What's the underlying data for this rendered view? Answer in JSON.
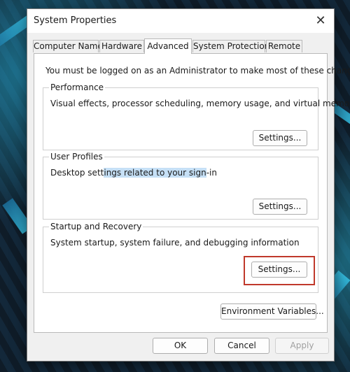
{
  "dialog": {
    "title": "System Properties",
    "close_glyph": "✕"
  },
  "tabs": [
    {
      "label": "Computer Name"
    },
    {
      "label": "Hardware"
    },
    {
      "label": "Advanced"
    },
    {
      "label": "System Protection"
    },
    {
      "label": "Remote"
    }
  ],
  "active_tab": "Advanced",
  "admin_note": "You must be logged on as an Administrator to make most of these changes.",
  "performance": {
    "title": "Performance",
    "description": "Visual effects, processor scheduling, memory usage, and virtual memory",
    "button": "Settings..."
  },
  "user_profiles": {
    "title": "User Profiles",
    "description_pre": "Desktop sett",
    "description_highlight": "ings related to your sign",
    "description_post": "-in",
    "button": "Settings..."
  },
  "startup_recovery": {
    "title": "Startup and Recovery",
    "description": "System startup, system failure, and debugging information",
    "button": "Settings..."
  },
  "env_vars_button": "Environment Variables...",
  "footer": {
    "ok": "OK",
    "cancel": "Cancel",
    "apply": "Apply"
  },
  "highlight_color": "#c0392b"
}
